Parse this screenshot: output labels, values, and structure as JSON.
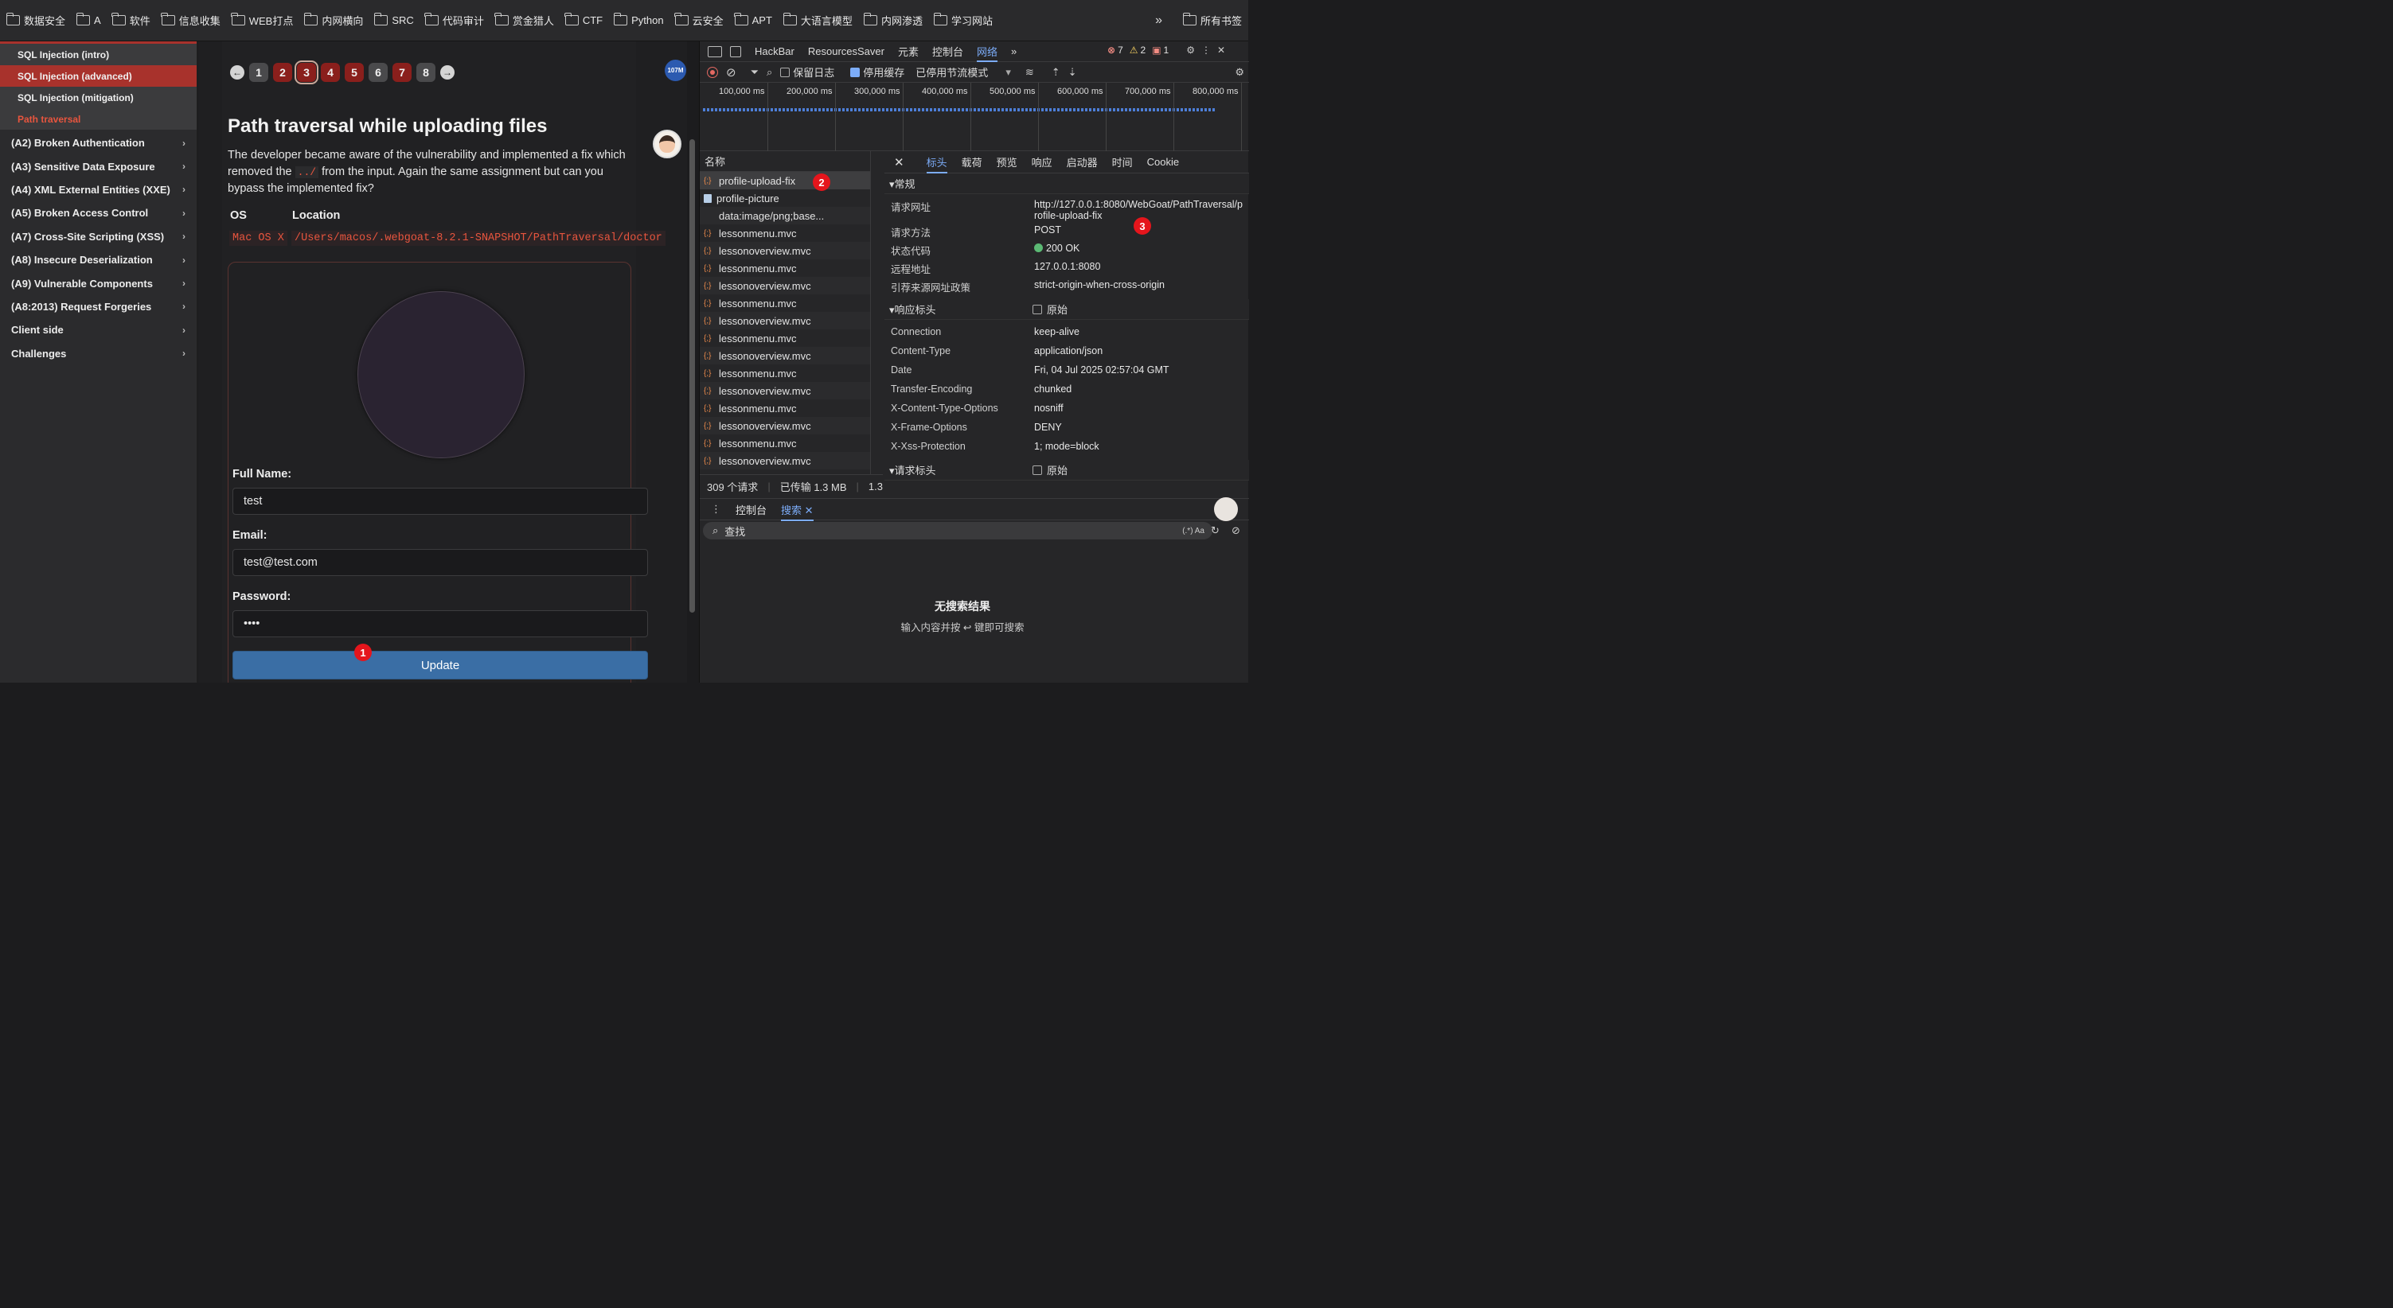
{
  "bookmarks": [
    "数据安全",
    "A",
    "软件",
    "信息收集",
    "WEB打点",
    "内网横向",
    "SRC",
    "代码审计",
    "赏金猎人",
    "CTF",
    "Python",
    "云安全",
    "APT",
    "大语言模型",
    "内网渗透",
    "学习网站"
  ],
  "bookmarks_more": "»",
  "bookmarks_all": "所有书签",
  "sidebar": {
    "sub_items": [
      "SQL Injection (intro)",
      "SQL Injection (advanced)",
      "SQL Injection (mitigation)",
      "Path traversal"
    ],
    "groups": [
      "(A2) Broken Authentication",
      "(A3) Sensitive Data Exposure",
      "(A4) XML External Entities (XXE)",
      "(A5) Broken Access Control",
      "(A7) Cross-Site Scripting (XSS)",
      "(A8) Insecure Deserialization",
      "(A9) Vulnerable Components",
      "(A8:2013) Request Forgeries",
      "Client side",
      "Challenges"
    ]
  },
  "pager": {
    "pages": [
      "1",
      "2",
      "3",
      "4",
      "5",
      "6",
      "7",
      "8"
    ],
    "current": "3",
    "red_pages": [
      "2",
      "3",
      "4",
      "5",
      "7"
    ]
  },
  "memory_badge": "107M",
  "lesson": {
    "title": "Path traversal while uploading files",
    "desc_part1": "The developer became aware of the vulnerability and implemented a fix which removed the",
    "desc_code": "../",
    "desc_part2": "from the input. Again the same assignment but can you bypass the implemented fix?",
    "table_headers": [
      "OS",
      "Location"
    ],
    "table_row": [
      "Mac OS X",
      "/Users/macos/.webgoat-8.2.1-SNAPSHOT/PathTraversal/doctor"
    ]
  },
  "form": {
    "full_name_label": "Full Name:",
    "full_name_value": "test",
    "email_label": "Email:",
    "email_value": "test@test.com",
    "password_label": "Password:",
    "password_value": "••••",
    "update_label": "Update"
  },
  "markers": [
    "1",
    "2",
    "3"
  ],
  "devtools": {
    "tabs": [
      "HackBar",
      "ResourcesSaver",
      "元素",
      "控制台",
      "网络"
    ],
    "tabs_more": "»",
    "error_count": "7",
    "warning_count": "2",
    "info_count": "1",
    "toolbar": {
      "preserve_log": "保留日志",
      "disable_cache": "停用缓存",
      "throttle": "已停用节流模式"
    },
    "timeline_ticks": [
      "100,000 ms",
      "200,000 ms",
      "300,000 ms",
      "400,000 ms",
      "500,000 ms",
      "600,000 ms",
      "700,000 ms",
      "800,000 ms"
    ],
    "list_header": "名称",
    "requests": [
      {
        "name": "profile-upload-fix",
        "icon": "fetch-icon"
      },
      {
        "name": "profile-picture",
        "icon": "image-icon"
      },
      {
        "name": "data:image/png;base...",
        "icon": "none"
      },
      {
        "name": "lessonmenu.mvc",
        "icon": "fetch-icon"
      },
      {
        "name": "lessonoverview.mvc",
        "icon": "fetch-icon"
      },
      {
        "name": "lessonmenu.mvc",
        "icon": "fetch-icon"
      },
      {
        "name": "lessonoverview.mvc",
        "icon": "fetch-icon"
      },
      {
        "name": "lessonmenu.mvc",
        "icon": "fetch-icon"
      },
      {
        "name": "lessonoverview.mvc",
        "icon": "fetch-icon"
      },
      {
        "name": "lessonmenu.mvc",
        "icon": "fetch-icon"
      },
      {
        "name": "lessonoverview.mvc",
        "icon": "fetch-icon"
      },
      {
        "name": "lessonmenu.mvc",
        "icon": "fetch-icon"
      },
      {
        "name": "lessonoverview.mvc",
        "icon": "fetch-icon"
      },
      {
        "name": "lessonmenu.mvc",
        "icon": "fetch-icon"
      },
      {
        "name": "lessonoverview.mvc",
        "icon": "fetch-icon"
      },
      {
        "name": "lessonmenu.mvc",
        "icon": "fetch-icon"
      },
      {
        "name": "lessonoverview.mvc",
        "icon": "fetch-icon"
      }
    ],
    "status_bar": {
      "requests": "309 个请求",
      "transferred": "已传输 1.3 MB",
      "resources": "1.3 M"
    },
    "detail_tabs": [
      "标头",
      "载荷",
      "预览",
      "响应",
      "启动器",
      "时间",
      "Cookie"
    ],
    "general_title": "▾常规",
    "general": [
      {
        "k": "请求网址",
        "v": "http://127.0.0.1:8080/WebGoat/PathTraversal/profile-upload-fix"
      },
      {
        "k": "请求方法",
        "v": "POST"
      },
      {
        "k": "状态代码",
        "v": "200 OK"
      },
      {
        "k": "远程地址",
        "v": "127.0.0.1:8080"
      },
      {
        "k": "引荐来源网址政策",
        "v": "strict-origin-when-cross-origin"
      }
    ],
    "response_title": "▾响应标头",
    "raw_label": "原始",
    "response_headers": [
      {
        "k": "Connection",
        "v": "keep-alive"
      },
      {
        "k": "Content-Type",
        "v": "application/json"
      },
      {
        "k": "Date",
        "v": "Fri, 04 Jul 2025 02:57:04 GMT"
      },
      {
        "k": "Transfer-Encoding",
        "v": "chunked"
      },
      {
        "k": "X-Content-Type-Options",
        "v": "nosniff"
      },
      {
        "k": "X-Frame-Options",
        "v": "DENY"
      },
      {
        "k": "X-Xss-Protection",
        "v": "1; mode=block"
      }
    ],
    "request_title": "▾请求标头",
    "drawer_tabs": [
      "控制台",
      "搜索"
    ],
    "search_placeholder": "查找",
    "search_opts": "(.*)  Aa",
    "no_result_title": "无搜索结果",
    "no_result_hint": "输入内容并按 ↩ 键即可搜索"
  },
  "colors": {
    "accent": "#7cacf8",
    "danger": "#a8322c",
    "update_button": "#3a6ea5",
    "marker": "#e5151c"
  }
}
